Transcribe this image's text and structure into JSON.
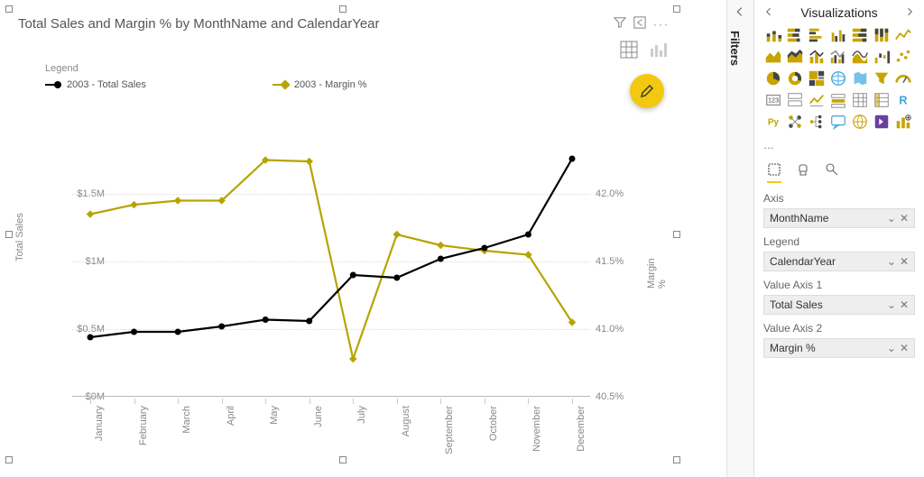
{
  "chart_data": {
    "type": "line",
    "title": "Total Sales and Margin % by MonthName and CalendarYear",
    "categories": [
      "January",
      "February",
      "March",
      "April",
      "May",
      "June",
      "July",
      "August",
      "September",
      "October",
      "November",
      "December"
    ],
    "series": [
      {
        "name": "2003 - Total Sales",
        "axis": "left",
        "color": "#000000",
        "values": [
          0.44,
          0.48,
          0.48,
          0.52,
          0.57,
          0.56,
          0.9,
          0.88,
          1.02,
          1.1,
          1.2,
          1.76
        ],
        "unit": "$M"
      },
      {
        "name": "2003 - Margin %",
        "axis": "right",
        "color": "#B6A400",
        "values": [
          41.85,
          41.92,
          41.95,
          41.95,
          42.25,
          42.24,
          40.78,
          41.7,
          41.62,
          41.58,
          41.55,
          41.05
        ],
        "unit": "%"
      }
    ],
    "xlabel": "",
    "y_left": {
      "label": "Total Sales",
      "ticks": [
        "$0M",
        "$0.5M",
        "$1M",
        "$1.5M"
      ],
      "lim": [
        0,
        2.0
      ]
    },
    "y_right": {
      "label": "Margin %",
      "ticks": [
        "40.5%",
        "41.0%",
        "41.5%",
        "42.0%"
      ],
      "lim": [
        40.5,
        42.5
      ]
    },
    "legend_title": "Legend"
  },
  "chart_toolbar": {
    "filter_tip": "Filter",
    "focus_tip": "Focus mode",
    "more_tip": "More options"
  },
  "filters_rail": {
    "label": "Filters"
  },
  "viz_pane": {
    "title": "Visualizations",
    "ellipsis": "…",
    "fields": {
      "axis": {
        "label": "Axis",
        "value": "MonthName"
      },
      "legend": {
        "label": "Legend",
        "value": "CalendarYear"
      },
      "value_axis1": {
        "label": "Value Axis 1",
        "value": "Total Sales"
      },
      "value_axis2": {
        "label": "Value Axis 2",
        "value": "Margin %"
      }
    }
  }
}
